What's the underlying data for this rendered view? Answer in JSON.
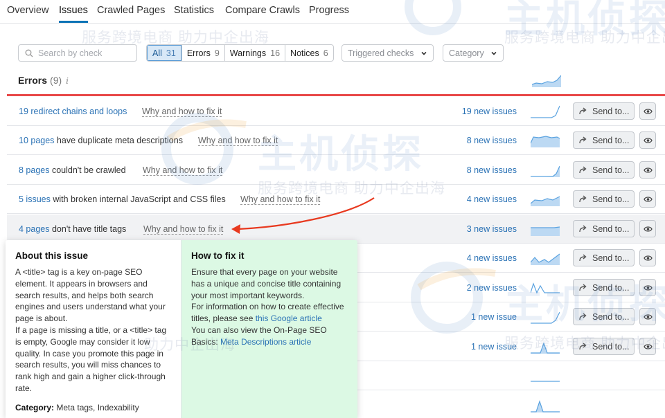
{
  "tabs": [
    {
      "label": "Overview",
      "active": false
    },
    {
      "label": "Issues",
      "active": true
    },
    {
      "label": "Crawled Pages",
      "active": false
    },
    {
      "label": "Statistics",
      "active": false
    },
    {
      "label": "Compare Crawls",
      "active": false
    },
    {
      "label": "Progress",
      "active": false
    }
  ],
  "search": {
    "placeholder": "Search by check",
    "icon": "search-icon"
  },
  "filters": [
    {
      "label": "All",
      "count": "31",
      "active": true
    },
    {
      "label": "Errors",
      "count": "9",
      "active": false
    },
    {
      "label": "Warnings",
      "count": "16",
      "active": false
    },
    {
      "label": "Notices",
      "count": "6",
      "active": false
    }
  ],
  "dropdowns": {
    "triggered": "Triggered checks",
    "category": "Category"
  },
  "errors_section": {
    "title": "Errors",
    "count": "(9)",
    "info": "i"
  },
  "rows": [
    {
      "link": "19 redirect chains and loops",
      "rest": "",
      "why": "Why and how to fix it",
      "issues": "19 new issues",
      "send": "Send to...",
      "spark": "rise"
    },
    {
      "link": "10 pages",
      "rest": " have duplicate meta descriptions",
      "why": "Why and how to fix it",
      "issues": "8 new issues",
      "send": "Send to...",
      "spark": "plateau"
    },
    {
      "link": "8 pages",
      "rest": " couldn't be crawled",
      "why": "Why and how to fix it",
      "issues": "8 new issues",
      "send": "Send to...",
      "spark": "rise"
    },
    {
      "link": "5 issues",
      "rest": " with broken internal JavaScript and CSS files",
      "why": "Why and how to fix it",
      "issues": "4 new issues",
      "send": "Send to...",
      "spark": "step"
    },
    {
      "link": "4 pages",
      "rest": " don't have title tags",
      "why": "Why and how to fix it",
      "issues": "3 new issues",
      "send": "Send to...",
      "spark": "flat"
    },
    {
      "link": "",
      "rest": "",
      "why": "",
      "issues": "4 new issues",
      "send": "Send to...",
      "spark": "wave"
    },
    {
      "link": "",
      "rest": "",
      "why": "",
      "issues": "2 new issues",
      "send": "Send to...",
      "spark": "zigzag"
    },
    {
      "link": "",
      "rest": "",
      "why": "",
      "issues": "1 new issue",
      "send": "Send to...",
      "spark": "rise"
    },
    {
      "link": "",
      "rest": "",
      "why": "",
      "issues": "1 new issue",
      "send": "Send to...",
      "spark": "spike"
    }
  ],
  "popup": {
    "about_title": "About this issue",
    "about_text": "A <title> tag is a key on-page SEO element. It appears in browsers and search results, and helps both search engines and users understand what your page is about.",
    "about_text2": "If a page is missing a title, or a <title> tag is empty, Google may consider it low quality. In case you promote this page in search results, you will miss chances to rank high and gain a higher click-through rate.",
    "category_label": "Category:",
    "category_value": " Meta tags, Indexability",
    "fix_title": "How to fix it",
    "fix_text": "Ensure that every page on your website has a unique and concise title containing your most important keywords.",
    "fix_text2": "For information on how to create effective titles, please see ",
    "fix_link1": "this Google article",
    "fix_text3": "You can also view the On-Page SEO Basics: ",
    "fix_link2": "Meta Descriptions article"
  },
  "watermark": {
    "slogan": "服务跨境电商 助力中企出海",
    "brand": "主机侦探"
  },
  "colors": {
    "accent": "#0c73b6",
    "link": "#2a72b5",
    "error_line": "#e84747",
    "fix_bg": "#dcf9e4"
  }
}
